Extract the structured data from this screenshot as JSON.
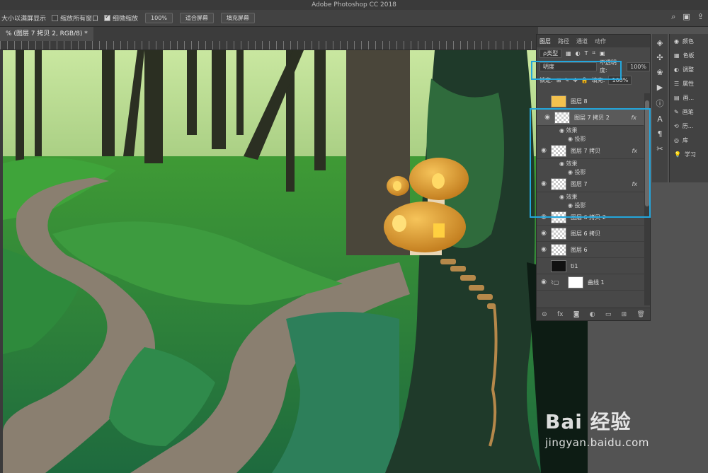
{
  "app": {
    "title": "Adobe Photoshop CC 2018"
  },
  "options": {
    "resize_windows": "大小以满屏显示",
    "zoom_all": "缩放所有窗口",
    "scrubby": "细微缩放",
    "zoom_value": "100%",
    "fit_screen": "适合屏幕",
    "fill_screen": "填充屏幕"
  },
  "doc_tab": "% (图层 7 拷贝 2, RGB/8) *",
  "layers_panel": {
    "tabs": [
      "图层",
      "路径",
      "通道",
      "动作"
    ],
    "filter_label": "ρ类型",
    "blend_mode": "明度",
    "opacity_label": "不透明度:",
    "opacity_value": "100%",
    "lock_label": "锁定:",
    "fill_label": "填充:",
    "fill_value": "100%",
    "layers": [
      {
        "name": "图层 8",
        "visible": false
      },
      {
        "name": "图层 7 拷贝 2",
        "visible": true,
        "fx": "fx",
        "effects": "效果",
        "effect": "投影"
      },
      {
        "name": "图层 7 拷贝",
        "visible": true,
        "fx": "fx",
        "effects": "效果",
        "effect": "投影"
      },
      {
        "name": "图层 7",
        "visible": true,
        "fx": "fx",
        "effects": "效果",
        "effect": "投影"
      },
      {
        "name": "图层 6 拷贝 2",
        "visible": true
      },
      {
        "name": "图层 6 拷贝",
        "visible": true
      },
      {
        "name": "图层 6",
        "visible": true
      },
      {
        "name": "ti1",
        "visible": false
      },
      {
        "name": "曲线 1",
        "visible": true
      }
    ]
  },
  "right_panel": {
    "items": [
      "颜色",
      "色板",
      "调整",
      "属性",
      "画...",
      "画笔",
      "历...",
      "库",
      "学习"
    ]
  },
  "watermark": {
    "brand": "Bai 经验",
    "url": "jingyan.baidu.com"
  }
}
